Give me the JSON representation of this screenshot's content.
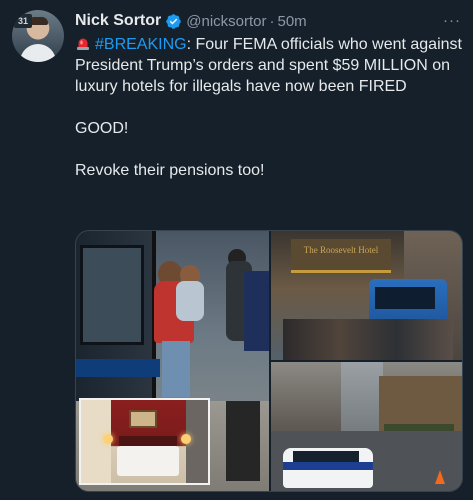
{
  "post": {
    "author_name": "Nick Sortor",
    "author_handle": "@nicksortor",
    "separator": "·",
    "timestamp": "50m",
    "more_label": "···",
    "avatar_badge": "31",
    "verified_color": "#1d9bf0",
    "text": {
      "hashtag": "#BREAKING",
      "line1_rest": ": Four FEMA officials who went against President Trump’s orders and spent $59 MILLION on luxury hotels for illegals have now been FIRED",
      "para2": "GOOD!",
      "para3": "Revoke their pensions too!"
    },
    "media": {
      "marquee_text": "The Roosevelt Hotel"
    }
  },
  "colors": {
    "background": "#15202b",
    "primary_text": "#e7e9ea",
    "secondary_text": "#8b98a5",
    "accent": "#1d9bf0"
  },
  "icons": [
    "verified-badge-icon",
    "siren-emoji-icon",
    "more-options-icon"
  ]
}
